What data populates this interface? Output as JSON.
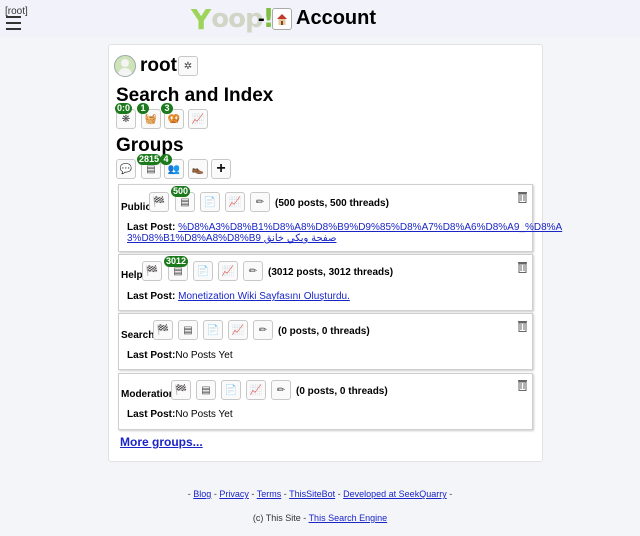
{
  "header": {
    "user_tag": "[root]",
    "logo_text": "Yoop!",
    "separator": "-",
    "title": "Account"
  },
  "profile": {
    "username": "root"
  },
  "search_index": {
    "title": "Search and Index",
    "buttons": [
      {
        "icon": "web-crawl-icon",
        "badge": "0:0"
      },
      {
        "icon": "basket-icon",
        "badge": "1"
      },
      {
        "icon": "pretzel-icon",
        "badge": "3"
      },
      {
        "icon": "chart-icon",
        "badge": ""
      }
    ]
  },
  "groups_section": {
    "title": "Groups",
    "buttons": [
      {
        "icon": "chat-bubble-icon",
        "badge": ""
      },
      {
        "icon": "feed-icon",
        "badge": "2815"
      },
      {
        "icon": "people-icon",
        "badge": "4"
      },
      {
        "icon": "crawl-shoe-icon",
        "badge": ""
      },
      {
        "icon": "plus-icon",
        "badge": ""
      }
    ]
  },
  "groups": [
    {
      "name": "Public",
      "badge": "500",
      "stats": "(500 posts, 500 threads)",
      "last_post_label": "Last Post:",
      "last_post_line1": "%D8%A3%D8%B1%D8%A8%D8%B9%D9%85%D8%A7%D8%A6%D8%A9_%D8%A",
      "last_post_line2": "3%D8%B1%D8%A8%D8%B9 صفحة ويكي خانق"
    },
    {
      "name": "Help",
      "badge": "3012",
      "stats": "(3012 posts, 3012 threads)",
      "last_post_label": "Last Post:",
      "last_post_line1": "Monetization Wiki Sayfasını Oluşturdu.",
      "last_post_line2": ""
    },
    {
      "name": "Search",
      "badge": "",
      "stats": "(0 posts, 0 threads)",
      "last_post_label": "Last Post:",
      "last_post_line1": "No Posts Yet",
      "last_post_line2": ""
    },
    {
      "name": "Moderation",
      "badge": "",
      "stats": "(0 posts, 0 threads)",
      "last_post_label": "Last Post:",
      "last_post_line1": "No Posts Yet",
      "last_post_line2": ""
    }
  ],
  "more_groups": "More groups...",
  "footer": {
    "links": [
      "Blog",
      "Privacy",
      "Terms",
      "ThisSiteBot",
      "Developed at SeekQuarry"
    ],
    "sep": "-",
    "copyright": "(c) This Site -",
    "engine_link": "This Search Engine"
  }
}
